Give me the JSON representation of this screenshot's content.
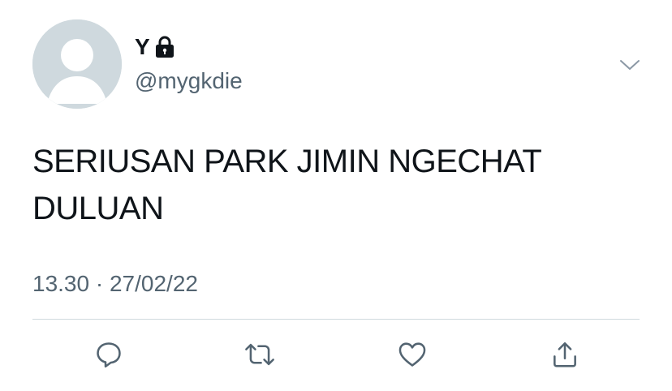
{
  "tweet": {
    "display_name": "Y",
    "handle": "@mygkdie",
    "text_line1": "SERIUSAN PARK JIMIN NGECHAT",
    "text_line2": "DULUAN",
    "time": "13.30",
    "separator": "·",
    "date": "27/02/22",
    "protected_icon": "lock-icon",
    "menu_icon": "chevron-down-icon"
  },
  "actions": {
    "reply_icon": "reply-icon",
    "retweet_icon": "retweet-icon",
    "like_icon": "heart-icon",
    "share_icon": "share-icon"
  },
  "colors": {
    "text": "#0f1419",
    "secondary": "#536471",
    "avatar_bg": "#cfd9de",
    "divider": "#cfd9de"
  }
}
